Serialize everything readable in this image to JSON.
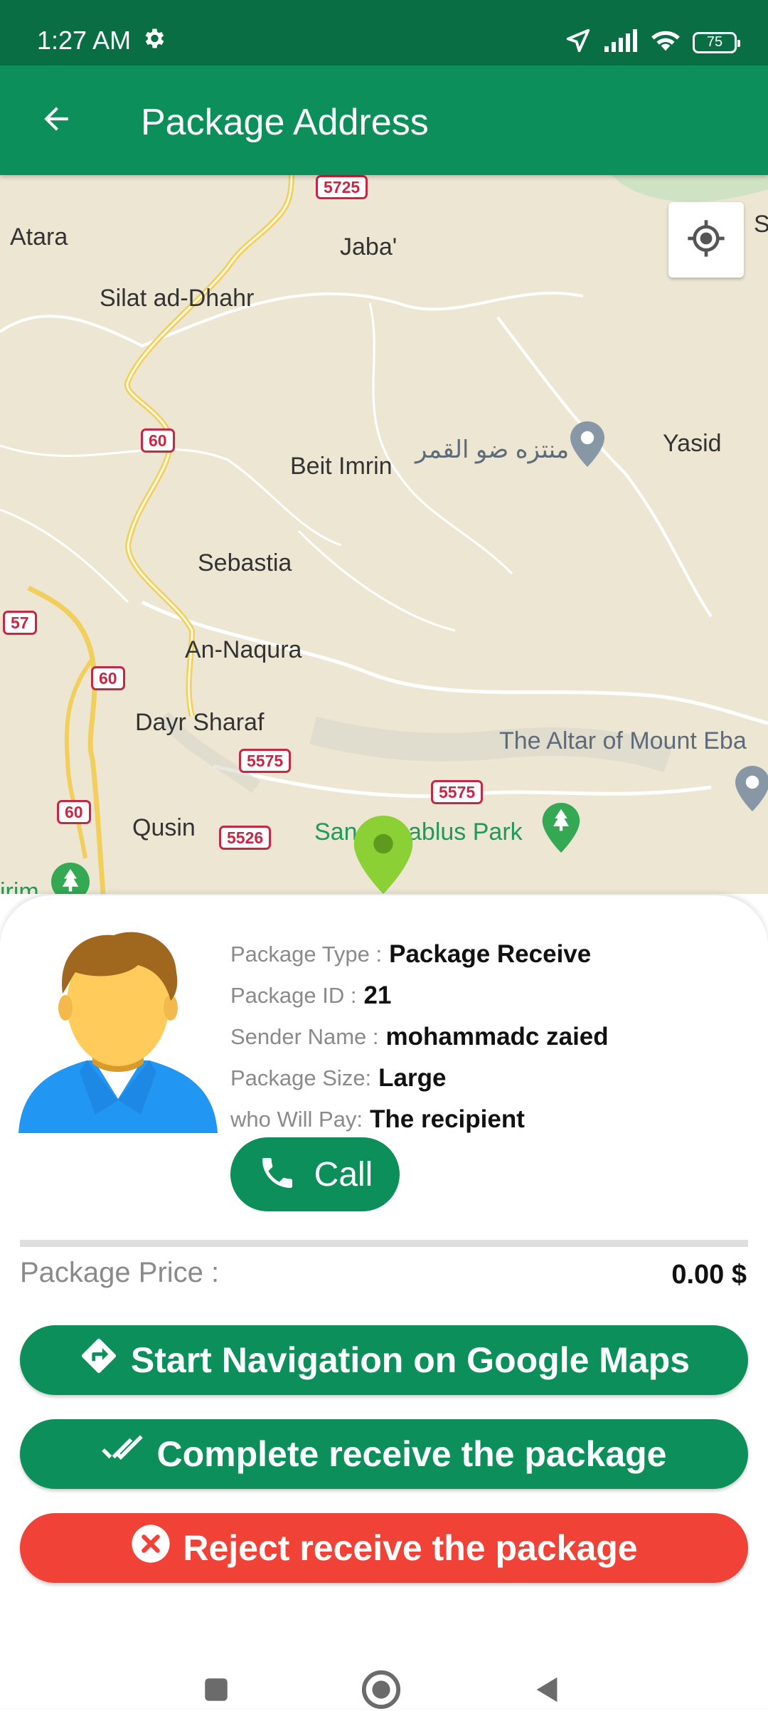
{
  "status_bar": {
    "time": "1:27 AM",
    "battery": "75",
    "icons": [
      "settings-gear-icon",
      "location-arrow-icon",
      "signal-icon",
      "wifi-icon",
      "battery-icon"
    ]
  },
  "app_bar": {
    "title": "Package Address",
    "back_icon": "arrow-back-icon"
  },
  "map": {
    "place_labels": [
      "Atara",
      "Jaba'",
      "Silat ad-Dhahr",
      "Beit Imrin",
      "منتزه ضو القمر",
      "Yasid",
      "Sebastia",
      "An-Naqura",
      "Dayr Sharaf",
      "The Altar of Mount Eba",
      "Qusin",
      "San",
      "ablus Park",
      "irim",
      "S"
    ],
    "road_numbers": [
      "5725",
      "60",
      "57",
      "60",
      "5575",
      "60",
      "5526",
      "5575"
    ],
    "locate_icon": "my-location-icon",
    "marker_color": "#8bd136"
  },
  "package": {
    "type_key": "Package Type :",
    "type_value": "Package Receive",
    "id_key": "Package ID :",
    "id_value": "21",
    "sender_key": "Sender Name :",
    "sender_value": "mohammadc zaied",
    "size_key": "Package Size:",
    "size_value": "Large",
    "payer_key": "who Will Pay:",
    "payer_value": "The recipient"
  },
  "call_button": {
    "label": "Call",
    "icon": "phone-icon"
  },
  "price": {
    "label": "Package Price :",
    "value": "0.00 $"
  },
  "actions": {
    "navigate": {
      "label": "Start Navigation on Google Maps",
      "icon": "directions-icon"
    },
    "complete": {
      "label": "Complete receive the package",
      "icon": "double-check-icon"
    },
    "reject": {
      "label": "Reject receive the package",
      "icon": "cancel-circle-icon"
    }
  },
  "colors": {
    "primary": "#0c8f5a",
    "status_bar": "#0a6e45",
    "reject": "#f04236",
    "map_bg": "#ece6d3"
  },
  "system_nav": [
    "recents-square-icon",
    "home-circle-icon",
    "back-triangle-icon"
  ]
}
